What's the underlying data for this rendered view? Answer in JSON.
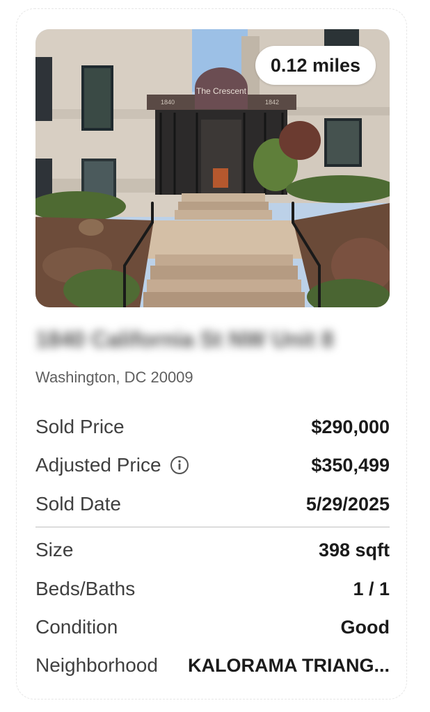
{
  "listing": {
    "distance": "0.12 miles",
    "address_street": "1840 California St NW Unit 8",
    "address_city": "Washington, DC 20009",
    "building_sign": "The Crescent",
    "building_numbers": [
      "1840",
      "1842"
    ]
  },
  "details": {
    "sold_price_label": "Sold Price",
    "sold_price_value": "$290,000",
    "adjusted_price_label": "Adjusted Price",
    "adjusted_price_value": "$350,499",
    "sold_date_label": "Sold Date",
    "sold_date_value": "5/29/2025",
    "size_label": "Size",
    "size_value": "398 sqft",
    "beds_baths_label": "Beds/Baths",
    "beds_baths_value": "1 / 1",
    "condition_label": "Condition",
    "condition_value": "Good",
    "neighborhood_label": "Neighborhood",
    "neighborhood_value": "KALORAMA TRIANG..."
  },
  "icons": {
    "adjusted_price_info": "info-icon"
  }
}
